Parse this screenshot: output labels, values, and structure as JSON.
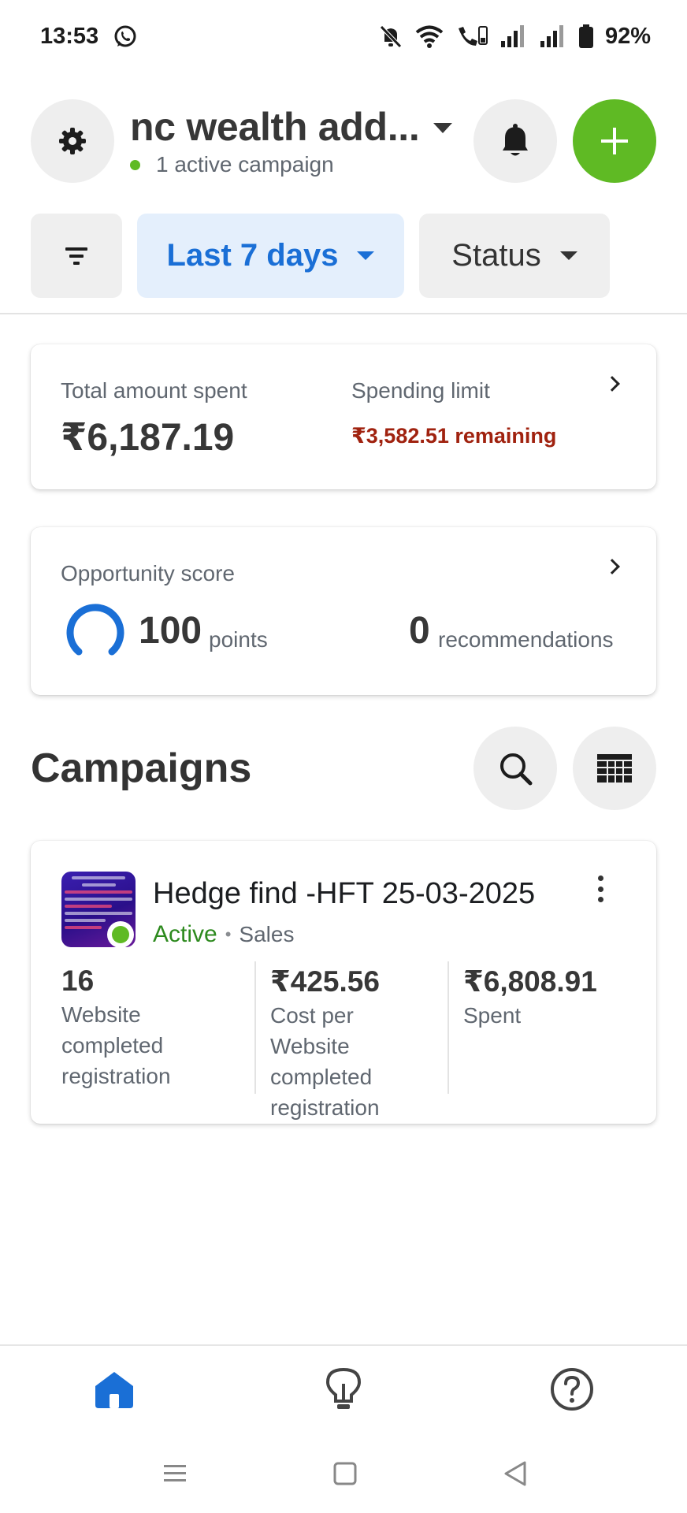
{
  "status_bar": {
    "time": "13:53",
    "battery": "92%",
    "icons": [
      "whatsapp-icon",
      "mute-bell-icon",
      "wifi-icon",
      "wifi-calling-icon",
      "signal-icon",
      "signal-icon",
      "battery-icon"
    ]
  },
  "header": {
    "account_name": "nc wealth add...",
    "subtitle": "1 active campaign",
    "status_dot_color": "#5fba24",
    "add_button_color": "#5fba24"
  },
  "filters": {
    "date_range": "Last 7 days",
    "status": "Status"
  },
  "spend": {
    "total_label": "Total amount spent",
    "total_value": "₹6,187.19",
    "limit_label": "Spending limit",
    "limit_remaining": "₹3,582.51 remaining"
  },
  "opportunity": {
    "label": "Opportunity score",
    "score": "100",
    "score_unit": "points",
    "recommendations": "0",
    "recommendations_unit": "recommendations"
  },
  "campaigns": {
    "title": "Campaigns",
    "items": [
      {
        "name": "Hedge find -HFT 25-03-2025",
        "status": "Active",
        "objective": "Sales",
        "metrics": [
          {
            "value": "16",
            "label": "Website completed registration"
          },
          {
            "value": "₹425.56",
            "label": "Cost per Website completed registration"
          },
          {
            "value": "₹6,808.91",
            "label": "Spent"
          }
        ]
      }
    ]
  },
  "bottom_nav": {
    "items": [
      "home-icon",
      "lightbulb-icon",
      "help-icon"
    ],
    "active_color": "#1a6fd6"
  }
}
